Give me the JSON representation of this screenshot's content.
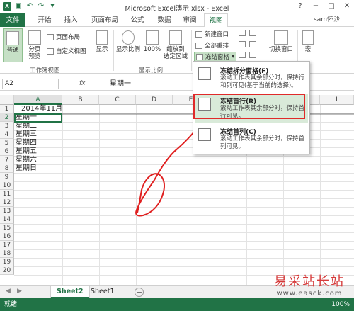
{
  "window": {
    "title": "Microsoft Excel演示.xlsx - Excel",
    "help": "?",
    "minimize": "−",
    "maximize": "□",
    "close": "✕"
  },
  "tabs": [
    "文件",
    "开始",
    "插入",
    "页面布局",
    "公式",
    "数据",
    "审阅",
    "视图"
  ],
  "active_tab": "视图",
  "user": "sam怀沙",
  "ribbon": {
    "normal": "普通",
    "page_break_1": "分页",
    "page_break_2": "预览",
    "page_layout": "页面布局",
    "custom_views": "自定义视图",
    "group_workbook_views": "工作簿视图",
    "show": "显示",
    "zoom": "显示比例",
    "zoom_100": "100%",
    "zoom_sel_1": "缩放到",
    "zoom_sel_2": "选定区域",
    "group_zoom": "显示比例",
    "new_window": "新建窗口",
    "arrange_all": "全部重排",
    "freeze_panes": "冻结窗格",
    "switch_windows": "切换窗口",
    "macros": "宏"
  },
  "formula_bar": {
    "name_box": "A2",
    "fx": "fx",
    "value": "星期一"
  },
  "columns": [
    "A",
    "B",
    "C",
    "D",
    "E",
    "F",
    "G",
    "H",
    "I"
  ],
  "rows": [
    "1",
    "2",
    "3",
    "4",
    "5",
    "6",
    "7",
    "8",
    "9",
    "10",
    "11",
    "12",
    "13",
    "14",
    "15",
    "16",
    "17",
    "18",
    "19",
    "20"
  ],
  "cells": {
    "A1": "2014年11月",
    "A2": "星期一",
    "A3": "星期二",
    "A4": "星期三",
    "A5": "星期四",
    "A6": "星期五",
    "A7": "星期六",
    "A8": "星期日"
  },
  "freeze_menu": [
    {
      "title": "冻结拆分窗格(F)",
      "desc": "滚动工作表其余部分时，保持行和列可见(基于当前的选择)。"
    },
    {
      "title": "冻结首行(R)",
      "desc": "滚动工作表其余部分时，保持首行可见。"
    },
    {
      "title": "冻结首列(C)",
      "desc": "滚动工作表其余部分时，保持首列可见。"
    }
  ],
  "sheets": [
    "Sheet2",
    "Sheet1"
  ],
  "active_sheet": "Sheet2",
  "status": {
    "ready": "就绪",
    "zoom": "100%"
  },
  "watermark": {
    "line1": "易采站长站",
    "line2": "www.easck.com"
  },
  "colors": {
    "accent": "#217346",
    "highlight_box": "#e02a2a",
    "menu_hover": "#d9ead9"
  }
}
